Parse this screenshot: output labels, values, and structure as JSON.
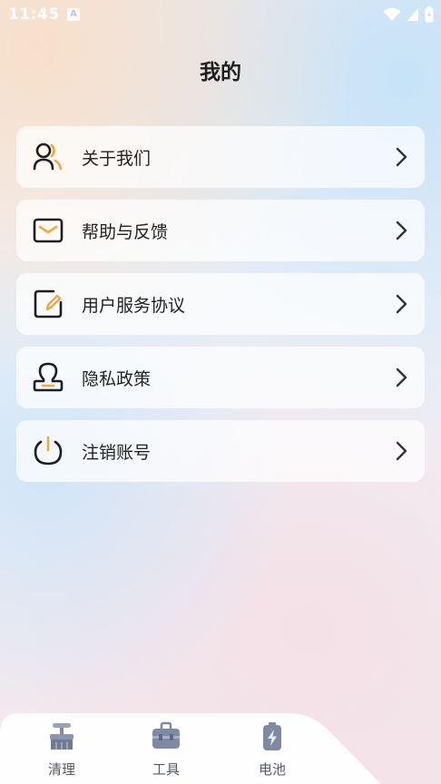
{
  "status_bar": {
    "time": "11:45",
    "notification_icon": "a-notification-icon",
    "right_icons": [
      "wifi-icon",
      "signal-icon",
      "battery-icon"
    ]
  },
  "page": {
    "title": "我的"
  },
  "menu": [
    {
      "label": "关于我们",
      "icon": "people-icon"
    },
    {
      "label": "帮助与反馈",
      "icon": "envelope-icon"
    },
    {
      "label": "用户服务协议",
      "icon": "document-edit-icon"
    },
    {
      "label": "隐私政策",
      "icon": "person-stamp-icon"
    },
    {
      "label": "注销账号",
      "icon": "power-icon"
    }
  ],
  "bottom_nav": [
    {
      "label": "清理",
      "icon": "broom-icon"
    },
    {
      "label": "工具",
      "icon": "toolbox-icon"
    },
    {
      "label": "电池",
      "icon": "battery-bolt-icon"
    }
  ],
  "colors": {
    "accent": "#f0a93b",
    "icon_dark": "#1e1e1e",
    "nav_icon": "#7e8aa3"
  }
}
